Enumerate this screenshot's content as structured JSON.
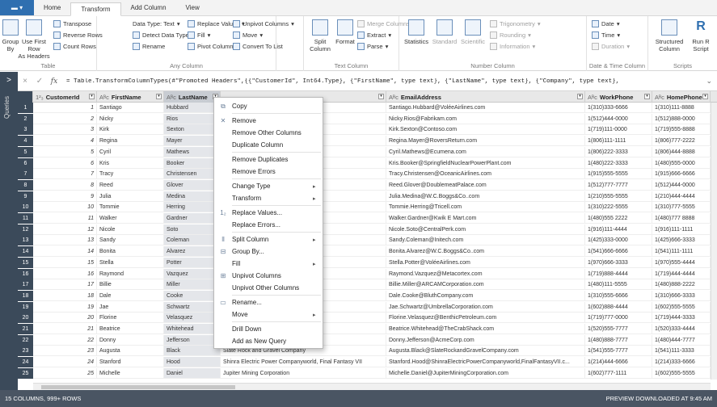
{
  "tabs": {
    "file": "",
    "items": [
      "Home",
      "Transform",
      "Add Column",
      "View"
    ],
    "active": "Transform"
  },
  "ribbon": {
    "table": {
      "label": "Table",
      "group_by": "Group By",
      "first_row_1": "Use First Row",
      "first_row_2": "As Headers",
      "transpose": "Transpose",
      "reverse_rows": "Reverse Rows",
      "count_rows": "Count Rows"
    },
    "any_column": {
      "label": "Any Column",
      "data_type": "Data Type: Text",
      "detect_type": "Detect Data Type",
      "rename": "Rename",
      "replace_values": "Replace Values",
      "fill": "Fill",
      "pivot_column": "Pivot Column",
      "unpivot_columns": "Unpivot Columns",
      "move": "Move",
      "convert_to_list": "Convert To List"
    },
    "text_column": {
      "label": "Text Column",
      "split_1": "Split",
      "split_2": "Column",
      "format": "Format",
      "merge_columns": "Merge Columns",
      "extract": "Extract",
      "parse": "Parse"
    },
    "number_column": {
      "label": "Number Column",
      "statistics": "Statistics",
      "standard": "Standard",
      "scientific": "Scientific",
      "trigonometry": "Trigonometry",
      "rounding": "Rounding",
      "information": "Information"
    },
    "date_time": {
      "label": "Date & Time Column",
      "date": "Date",
      "time": "Time",
      "duration": "Duration"
    },
    "scripts": {
      "label": "Scripts",
      "structured_1": "Structured",
      "structured_2": "Column",
      "run_r_1": "Run R",
      "run_r_2": "Script"
    }
  },
  "queries_pane": {
    "label": "Queries",
    "arrow": ">"
  },
  "formula": {
    "text": "= Table.TransformColumnTypes(#\"Promoted Headers\",{{\"CustomerId\", Int64.Type}, {\"FirstName\", type text}, {\"LastName\", type text}, {\"Company\", type text},",
    "cancel": "×",
    "confirm": "✓",
    "fx": "fx",
    "expand": "⌄"
  },
  "grid": {
    "columns": [
      {
        "type": "1²₃",
        "name": "CustomerId"
      },
      {
        "type": "Aᴮc",
        "name": "FirstName"
      },
      {
        "type": "Aᴮc",
        "name": "LastName"
      },
      {
        "type": "",
        "name": ""
      },
      {
        "type": "Aᴮc",
        "name": "EmailAddress"
      },
      {
        "type": "Aᴮc",
        "name": "WorkPhone"
      },
      {
        "type": "Aᴮc",
        "name": "HomePhone"
      }
    ],
    "rows": [
      [
        "1",
        "1",
        "Santiago",
        "Hubbard",
        "",
        "Santiago.Hubbard@VoléeAirlines.com",
        "1(310)333-6666",
        "1(310)111-8888"
      ],
      [
        "2",
        "2",
        "Nicky",
        "Rios",
        "",
        "Nicky.Rios@Fabrikam.com",
        "1(512)444-0000",
        "1(512)888-0000"
      ],
      [
        "3",
        "3",
        "Kirk",
        "Sexton",
        "",
        "Kirk.Sexton@Contoso.com",
        "1(719)111-0000",
        "1(719)555-8888"
      ],
      [
        "4",
        "4",
        "Regina",
        "Mayer",
        "",
        "Regina.Mayer@RoversReturn.com",
        "1(806)111-1111",
        "1(806)777-2222"
      ],
      [
        "5",
        "5",
        "Cyril",
        "Mathews",
        "",
        "Cyril.Mathews@Ecumena.com",
        "1(806)222-3333",
        "1(806)444-8888"
      ],
      [
        "6",
        "6",
        "Kris",
        "Booker",
        "t",
        "Kris.Booker@SpringfieldNuclearPowerPlant.com",
        "1(480)222-3333",
        "1(480)555-0000"
      ],
      [
        "7",
        "7",
        "Tracy",
        "Christensen",
        "",
        "Tracy.Christensen@OceanicAirlines.com",
        "1(915)555-5555",
        "1(915)666-6666"
      ],
      [
        "8",
        "8",
        "Reed",
        "Glover",
        "",
        "Reed.Glover@DoublemeatPalace.com",
        "1(512)777-7777",
        "1(512)444-0000"
      ],
      [
        "9",
        "9",
        "Julia",
        "Medina",
        "",
        "Julia.Medina@W.C.Boggs&Co..com",
        "1(210)555-5555",
        "1(210)444-4444"
      ],
      [
        "10",
        "10",
        "Tommie",
        "Herring",
        "",
        "Tommie.Herring@Tricell.com",
        "1(310)222-5555",
        "1(310)777-5555"
      ],
      [
        "11",
        "11",
        "Walker",
        "Gardner",
        "",
        "Walker.Gardner@Kwik E Mart.com",
        "1(480)555 2222",
        "1(480)777 8888"
      ],
      [
        "12",
        "12",
        "Nicole",
        "Soto",
        "",
        "Nicole.Soto@CentralPerk.com",
        "1(916)111-4444",
        "1(916)111-1111"
      ],
      [
        "13",
        "13",
        "Sandy",
        "Coleman",
        "",
        "Sandy.Coleman@Initech.com",
        "1(425)333-0000",
        "1(425)666-3333"
      ],
      [
        "14",
        "14",
        "Bonita",
        "Alvarez",
        "",
        "Bonita.Alvarez@W.C.Boggs&Co..com",
        "1(541)666-6666",
        "1(541)111-1111"
      ],
      [
        "15",
        "15",
        "Stella",
        "Potter",
        "",
        "Stella.Potter@VoléeAirlines.com",
        "1(970)666-3333",
        "1(970)555-4444"
      ],
      [
        "16",
        "16",
        "Raymond",
        "Vazquez",
        "",
        "Raymond.Vazquez@Metacortex.com",
        "1(719)888-4444",
        "1(719)444-4444"
      ],
      [
        "17",
        "17",
        "Billie",
        "Miller",
        "",
        "Billie.Miller@ARCAMCorporation.com",
        "1(480)111-5555",
        "1(480)888-2222"
      ],
      [
        "18",
        "18",
        "Dale",
        "Cooke",
        "",
        "Dale.Cooke@BluthCompany.com",
        "1(310)555-6666",
        "1(310)666-3333"
      ],
      [
        "19",
        "19",
        "Jae",
        "Schwartz",
        "",
        "Jae.Schwartz@UmbrellaCorporation.com",
        "1(602)888-4444",
        "1(602)555-5555"
      ],
      [
        "20",
        "20",
        "Florine",
        "Velasquez",
        "",
        "Florine.Velasquez@BenthicPetroleum.com",
        "1(719)777-0000",
        "1(719)444-3333"
      ],
      [
        "21",
        "21",
        "Beatrice",
        "Whitehead",
        "",
        "Beatrice.Whitehead@TheCrabShack.com",
        "1(520)555-7777",
        "1(520)333-4444"
      ],
      [
        "22",
        "22",
        "Donny",
        "Jefferson",
        "",
        "Donny.Jefferson@AcmeCorp.com",
        "1(480)888-7777",
        "1(480)444-7777"
      ],
      [
        "23",
        "23",
        "Augusta",
        "Black",
        "Slate Rock and Gravel Company",
        "Augusta.Black@SlateRockandGravelCompany.com",
        "1(541)555-7777",
        "1(541)111-3333"
      ],
      [
        "24",
        "24",
        "Stanford",
        "Hood",
        "Shinra Electric Power Companyworld, Final Fantasy VII",
        "Stanford.Hood@ShinraElectricPowerCompanyworld,FinalFantasyVII.c...",
        "1(214)444-6666",
        "1(214)333-6666"
      ],
      [
        "25",
        "25",
        "Michelle",
        "Daniel",
        "Jupiter Mining Corporation",
        "Michelle.Daniel@JupiterMiningCorporation.com",
        "1(602)777-1111",
        "1(602)555-5555"
      ]
    ]
  },
  "context_menu": [
    {
      "icon": "⧉",
      "label": "Copy",
      "sep_after": true
    },
    {
      "icon": "✕",
      "label": "Remove"
    },
    {
      "icon": "",
      "label": "Remove Other Columns"
    },
    {
      "icon": "",
      "label": "Duplicate Column",
      "sep_after": true
    },
    {
      "icon": "",
      "label": "Remove Duplicates"
    },
    {
      "icon": "",
      "label": "Remove Errors",
      "sep_after": true
    },
    {
      "icon": "",
      "label": "Change Type",
      "sub": true
    },
    {
      "icon": "",
      "label": "Transform",
      "sub": true,
      "sep_after": true
    },
    {
      "icon": "1₂",
      "label": "Replace Values..."
    },
    {
      "icon": "",
      "label": "Replace Errors...",
      "sep_after": true
    },
    {
      "icon": "⫴",
      "label": "Split Column",
      "sub": true
    },
    {
      "icon": "⊟",
      "label": "Group By..."
    },
    {
      "icon": "",
      "label": "Fill",
      "sub": true
    },
    {
      "icon": "⊞",
      "label": "Unpivot Columns"
    },
    {
      "icon": "",
      "label": "Unpivot Other Columns",
      "sep_after": true
    },
    {
      "icon": "▭",
      "label": "Rename..."
    },
    {
      "icon": "",
      "label": "Move",
      "sub": true,
      "sep_after": true
    },
    {
      "icon": "",
      "label": "Drill Down"
    },
    {
      "icon": "",
      "label": "Add as New Query"
    }
  ],
  "status": {
    "left": "15 COLUMNS, 999+ ROWS",
    "right": "PREVIEW DOWNLOADED AT 9:45 AM"
  }
}
